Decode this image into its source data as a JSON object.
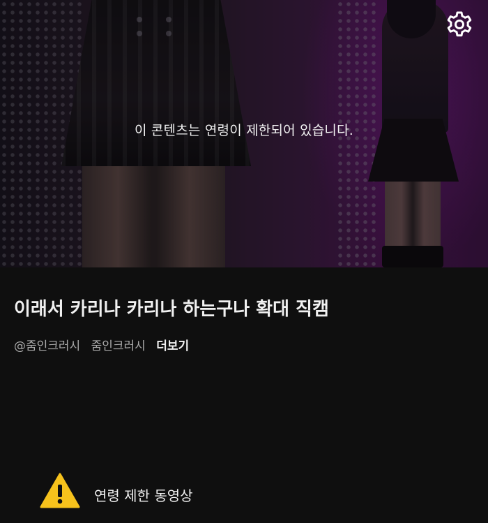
{
  "player": {
    "restricted_message": "이 콘텐츠는 연령이 제한되어 있습니다.",
    "settings_icon": "gear-icon"
  },
  "video": {
    "title": "이래서 카리나 카리나 하는구나 확대 직캠",
    "channel_handle": "@줌인크러시",
    "channel_name": "줌인크러시",
    "more_label": "더보기"
  },
  "notice": {
    "icon": "warning-icon",
    "text": "연령 제한 동영상",
    "icon_color": "#f6c21c"
  },
  "colors": {
    "background": "#0f0f0f",
    "accent_purple": "#4a1650"
  }
}
